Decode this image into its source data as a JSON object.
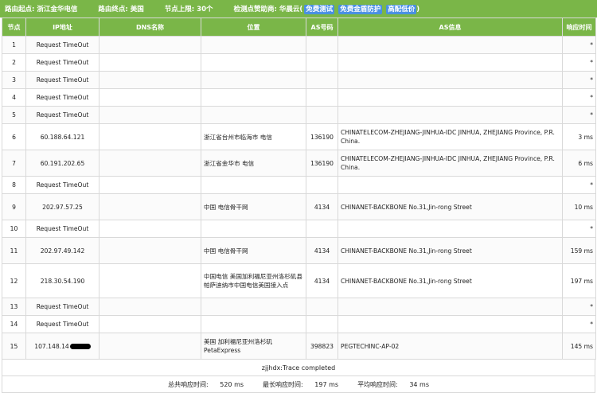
{
  "header": {
    "origin_label": "路由起点:",
    "origin_value": "浙江金华电信",
    "dest_label": "路由终点:",
    "dest_value": "美国",
    "limit_label": "节点上限:",
    "limit_value": "30个",
    "sponsor_label": "检测点赞助商:",
    "sponsor_name": "华晨云",
    "sponsor_paren_open": "(",
    "sponsor_link1": "免费测试",
    "sponsor_link2": "免费金盾防护",
    "sponsor_link3": "高配低价",
    "sponsor_paren_close": ")"
  },
  "columns": [
    "节点",
    "IP地址",
    "DNS名称",
    "位置",
    "AS号码",
    "AS信息",
    "响应时间"
  ],
  "rows": [
    {
      "node": "1",
      "ip": "Request TimeOut",
      "dns": "",
      "loc": "",
      "as": "",
      "info": "",
      "time": "*"
    },
    {
      "node": "2",
      "ip": "Request TimeOut",
      "dns": "",
      "loc": "",
      "as": "",
      "info": "",
      "time": "*"
    },
    {
      "node": "3",
      "ip": "Request TimeOut",
      "dns": "",
      "loc": "",
      "as": "",
      "info": "",
      "time": "*"
    },
    {
      "node": "4",
      "ip": "Request TimeOut",
      "dns": "",
      "loc": "",
      "as": "",
      "info": "",
      "time": "*"
    },
    {
      "node": "5",
      "ip": "Request TimeOut",
      "dns": "",
      "loc": "",
      "as": "",
      "info": "",
      "time": "*"
    },
    {
      "node": "6",
      "ip": "60.188.64.121",
      "dns": "",
      "loc": "浙江省台州市临海市 电信",
      "as": "136190",
      "info": "CHINATELECOM-ZHEJIANG-JINHUA-IDC JINHUA, ZHEJIANG Province, P.R. China.",
      "time": "3 ms"
    },
    {
      "node": "7",
      "ip": "60.191.202.65",
      "dns": "",
      "loc": "浙江省金华市 电信",
      "as": "136190",
      "info": "CHINATELECOM-ZHEJIANG-JINHUA-IDC JINHUA, ZHEJIANG Province, P.R. China.",
      "time": "6 ms"
    },
    {
      "node": "8",
      "ip": "Request TimeOut",
      "dns": "",
      "loc": "",
      "as": "",
      "info": "",
      "time": "*"
    },
    {
      "node": "9",
      "ip": "202.97.57.25",
      "dns": "",
      "loc": "中国 电信骨干网",
      "as": "4134",
      "info": "CHINANET-BACKBONE No.31,Jin-rong Street",
      "time": "10 ms"
    },
    {
      "node": "10",
      "ip": "Request TimeOut",
      "dns": "",
      "loc": "",
      "as": "",
      "info": "",
      "time": "*"
    },
    {
      "node": "11",
      "ip": "202.97.49.142",
      "dns": "",
      "loc": "中国 电信骨干网",
      "as": "4134",
      "info": "CHINANET-BACKBONE No.31,Jin-rong Street",
      "time": "159 ms"
    },
    {
      "node": "12",
      "ip": "218.30.54.190",
      "dns": "",
      "loc": "中国电信 美国加利福尼亚州洛杉矶县帕萨迪纳市中国电信美国接入点",
      "as": "4134",
      "info": "CHINANET-BACKBONE No.31,Jin-rong Street",
      "time": "197 ms"
    },
    {
      "node": "13",
      "ip": "Request TimeOut",
      "dns": "",
      "loc": "",
      "as": "",
      "info": "",
      "time": "*"
    },
    {
      "node": "14",
      "ip": "Request TimeOut",
      "dns": "",
      "loc": "",
      "as": "",
      "info": "",
      "time": "*"
    },
    {
      "node": "15",
      "ip": "107.148.14",
      "dns": "",
      "loc": "美国 加利福尼亚州洛杉矶PetaExpress",
      "as": "398823",
      "info": "PEGTECHINC-AP-02",
      "time": "145 ms"
    }
  ],
  "footer": {
    "trace_status": "zjjhdx:Trace completed",
    "total_label": "总共响应时间:",
    "total_value": "520 ms",
    "max_label": "最长响应时间:",
    "max_value": "197 ms",
    "avg_label": "平均响应时间:",
    "avg_value": "34 ms"
  },
  "colors": {
    "accent": "#7ab648"
  }
}
